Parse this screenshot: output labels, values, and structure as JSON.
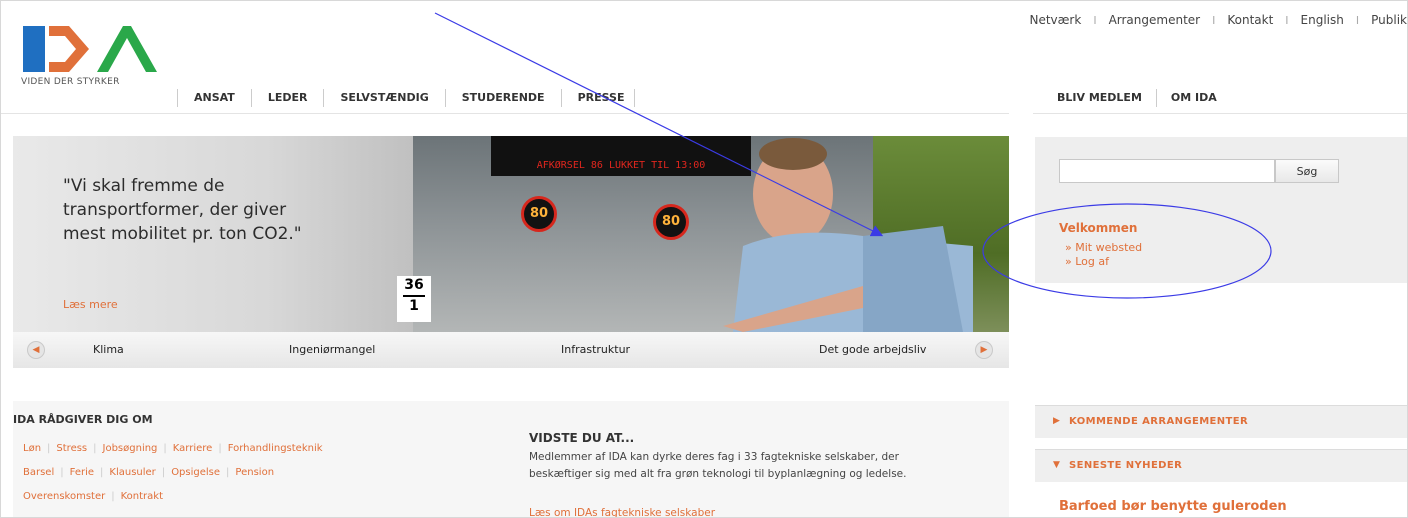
{
  "brand": {
    "tagline": "VIDEN DER STYRKER",
    "logo_text": "IDA",
    "accent": "#e0703a",
    "logo_blue": "#1f6fc1"
  },
  "topnav": [
    "Netværk",
    "Arrangementer",
    "Kontakt",
    "English",
    "Publik"
  ],
  "mainnav": [
    "ANSAT",
    "LEDER",
    "SELVSTÆNDIG",
    "STUDERENDE",
    "PRESSE"
  ],
  "rightnav": [
    "BLIV MEDLEM",
    "OM IDA"
  ],
  "hero": {
    "quote": "\"Vi skal fremme de transportformer, der giver mest mobilitet pr. ton CO2.\"",
    "read_more": "Læs mere",
    "sign_text": "AFKØRSEL 86 LUKKET TIL 13:00",
    "speed1": "80",
    "speed2": "80",
    "km_top": "36",
    "km_bottom": "1",
    "strip": [
      "Klima",
      "Ingeniørmangel",
      "Infrastruktur",
      "Det gode arbejdsliv"
    ]
  },
  "search": {
    "button": "Søg",
    "placeholder": ""
  },
  "welcome": {
    "title": "Velkommen",
    "links": [
      "Mit websted",
      "Log af"
    ]
  },
  "advice": {
    "title": "IDA RÅDGIVER DIG OM",
    "row1": [
      "Løn",
      "Stress",
      "Jobsøgning",
      "Karriere",
      "Forhandlingsteknik"
    ],
    "row2": [
      "Barsel",
      "Ferie",
      "Klausuler",
      "Opsigelse",
      "Pension"
    ],
    "row3": [
      "Overenskomster",
      "Kontrakt"
    ]
  },
  "didyouknow": {
    "title": "VIDSTE DU AT...",
    "text": "Medlemmer af IDA kan dyrke deres fag i 33 fagtekniske selskaber, der beskæftiger sig med alt fra grøn teknologi til byplanlægning og ledelse.",
    "link": "Læs om IDAs fagtekniske selskaber"
  },
  "sidebar": {
    "events": "KOMMENDE ARRANGEMENTER",
    "news": "SENESTE NYHEDER",
    "headline": "Barfoed bør benytte guleroden"
  },
  "annotation_color": "#3b3be6"
}
